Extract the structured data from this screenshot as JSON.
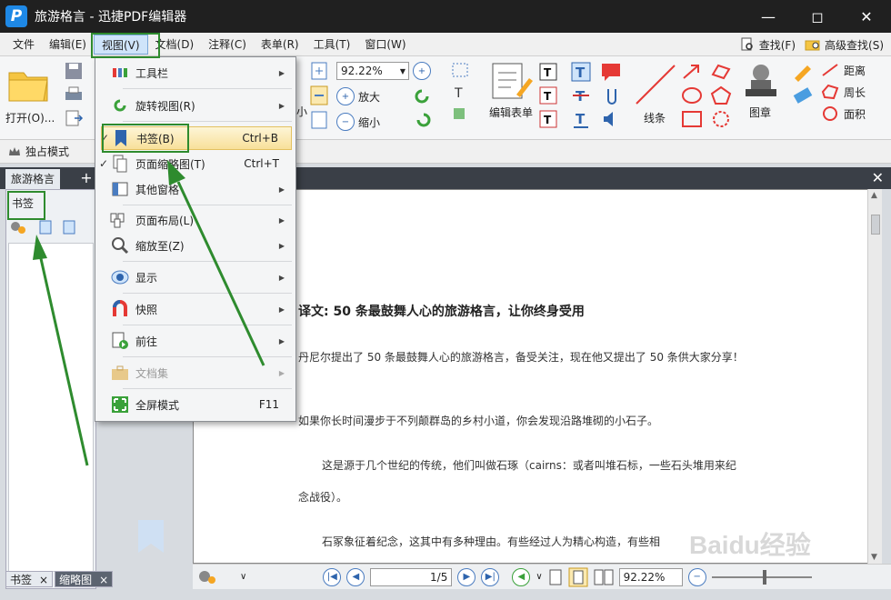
{
  "window": {
    "title": "旅游格言 - 迅捷PDF编辑器"
  },
  "menubar": {
    "items": [
      "文件",
      "编辑(E)",
      "视图(V)",
      "文档(D)",
      "注释(C)",
      "表单(R)",
      "工具(T)",
      "窗口(W)"
    ],
    "find": "查找(F)",
    "advanced_find": "高级查找(S)"
  },
  "toolbar": {
    "open": "打开(O)...",
    "zoom_value": "92.22%",
    "zoom_in": "放大",
    "zoom_out": "缩小",
    "small_label": "小",
    "edit_form": "编辑表单",
    "line": "线条",
    "stamp": "图章",
    "distance": "距离",
    "perimeter": "周长",
    "area": "面积"
  },
  "modebar": {
    "exclusive": "独占模式"
  },
  "tabs": {
    "doc": "旅游格言"
  },
  "leftpanel": {
    "title": "书签",
    "bottom_tab1": "书签",
    "bottom_tab2": "缩略图"
  },
  "view_menu": {
    "items": [
      {
        "label": "工具栏",
        "shortcut": "",
        "submenu": true
      },
      {
        "label": "旋转视图(R)",
        "shortcut": "",
        "submenu": true
      },
      {
        "label": "书签(B)",
        "shortcut": "Ctrl+B",
        "submenu": false
      },
      {
        "label": "页面缩略图(T)",
        "shortcut": "Ctrl+T",
        "submenu": false
      },
      {
        "label": "其他窗格",
        "shortcut": "",
        "submenu": true
      },
      {
        "label": "页面布局(L)",
        "shortcut": "",
        "submenu": true
      },
      {
        "label": "缩放至(Z)",
        "shortcut": "",
        "submenu": true
      },
      {
        "label": "显示",
        "shortcut": "",
        "submenu": true
      },
      {
        "label": "快照",
        "shortcut": "",
        "submenu": true
      },
      {
        "label": "前往",
        "shortcut": "",
        "submenu": true
      },
      {
        "label": "文档集",
        "shortcut": "",
        "submenu": true
      },
      {
        "label": "全屏模式",
        "shortcut": "F11",
        "submenu": false
      }
    ]
  },
  "document": {
    "heading": "译文: 50 条最鼓舞人心的旅游格言，让你终身受用",
    "p1": "丹尼尔提出了 50 条最鼓舞人心的旅游格言，备受关注，现在他又提出了 50 条供大家分享！",
    "p2": "如果你长时间漫步于不列颠群岛的乡村小道，你会发现沿路堆砌的小石子。",
    "p3a": "这是源于几个世纪的传统，他们叫做石琢（cairns：或者叫堆石标，一些石头堆用来纪",
    "p3b": "念战役）。",
    "p4": "石冢象征着纪念，这其中有多种理由。有些经过人为精心构造，有些相"
  },
  "statusbar": {
    "page": "1/5",
    "zoom": "92.22%"
  },
  "watermark": "Baidu经验",
  "colors": {
    "annotation_green": "#2e8b2e",
    "titlebar": "#202020",
    "menu_highlight": "#f8e09a"
  }
}
